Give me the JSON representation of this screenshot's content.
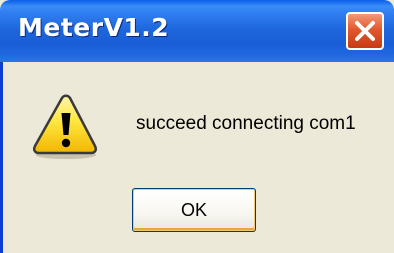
{
  "window": {
    "title": "MeterV1.2",
    "close_icon": "close-icon"
  },
  "content": {
    "icon": "warning-icon",
    "message": "succeed connecting com1"
  },
  "buttons": {
    "ok_label": "OK"
  }
}
